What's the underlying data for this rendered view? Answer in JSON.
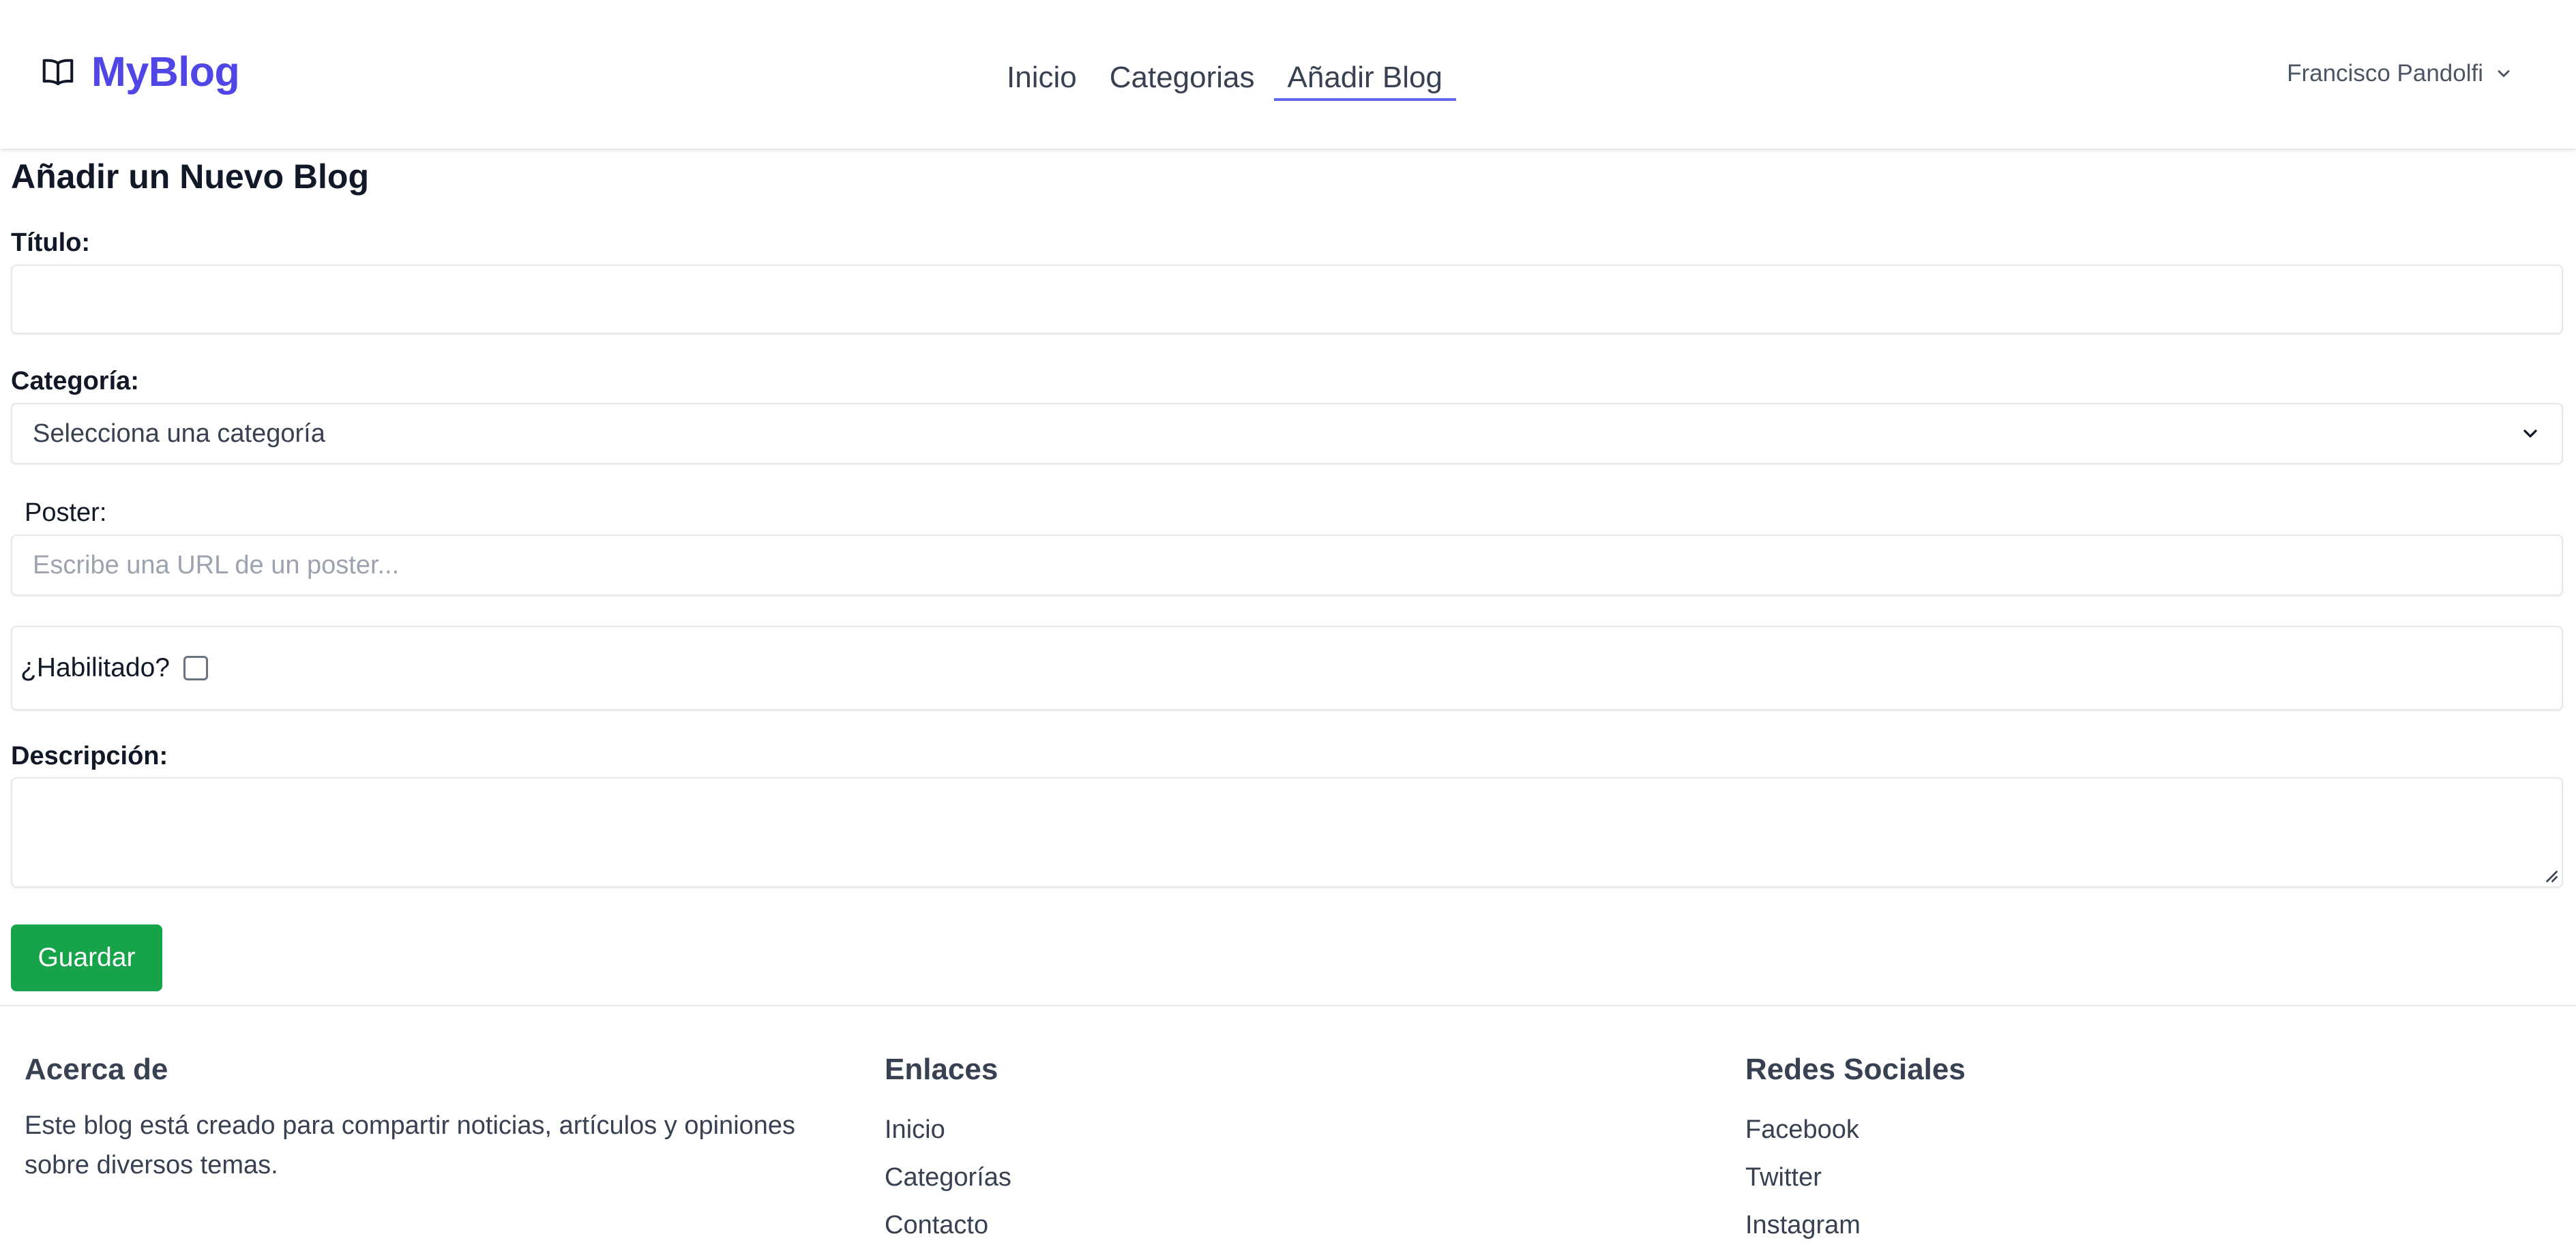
{
  "navbar": {
    "brand": "MyBlog",
    "brand_icon": "book-open-icon",
    "links": [
      {
        "label": "Inicio"
      },
      {
        "label": "Categorias"
      },
      {
        "label": "Añadir Blog",
        "active": true
      }
    ],
    "user_name": "Francisco Pandolfi",
    "accent_color": "#4f46e5"
  },
  "form": {
    "title": "Añadir un Nuevo Blog",
    "titulo_label": "Título:",
    "titulo_value": "",
    "categoria_label": "Categoría:",
    "categoria_selected": "Selecciona una categoría",
    "poster_label": "Poster:",
    "poster_placeholder": "Escribe una URL de un poster...",
    "habilitado_label": "¿Habilitado?",
    "habilitado_checked": false,
    "descripcion_label": "Descripción:",
    "descripcion_value": "",
    "save_label": "Guardar",
    "save_color": "#16a34a"
  },
  "footer": {
    "about": {
      "title": "Acerca de",
      "text": "Este blog está creado para compartir noticias, artículos y opiniones sobre diversos temas."
    },
    "links": {
      "title": "Enlaces",
      "items": [
        "Inicio",
        "Categorías",
        "Contacto"
      ]
    },
    "social": {
      "title": "Redes Sociales",
      "items": [
        "Facebook",
        "Twitter",
        "Instagram"
      ]
    }
  }
}
